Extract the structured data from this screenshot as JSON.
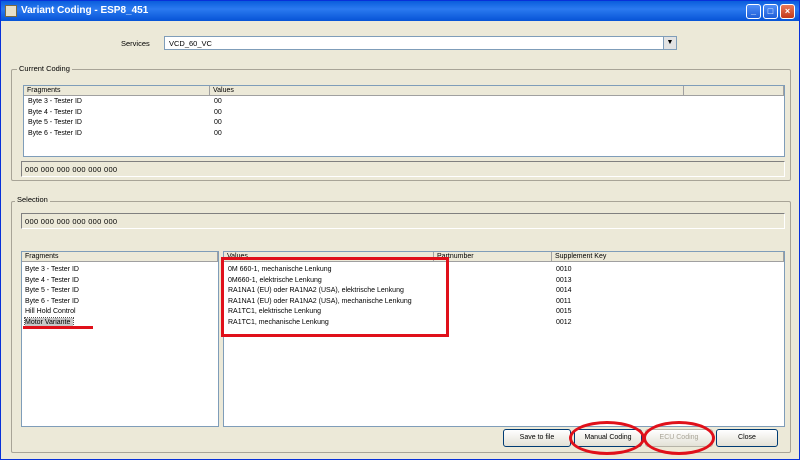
{
  "window": {
    "title": "Variant Coding - ESP8_451",
    "min_glyph": "_",
    "max_glyph": "□",
    "close_glyph": "×"
  },
  "services": {
    "label": "Services",
    "value": "VCD_60_VC",
    "arrow_glyph": "▼"
  },
  "current_coding": {
    "group_label": "Current Coding",
    "headers": [
      "Fragments",
      "Values"
    ],
    "rows": [
      {
        "fragment": "Byte 3 - Tester ID",
        "value": "00"
      },
      {
        "fragment": "Byte 4 - Tester ID",
        "value": "00"
      },
      {
        "fragment": "Byte 5 - Tester ID",
        "value": "00"
      },
      {
        "fragment": "Byte 6 - Tester ID",
        "value": "00"
      }
    ],
    "coding_string": "000  000  000  000  000  000"
  },
  "selection": {
    "group_label": "Selection",
    "coding_string": "000  000  000  000  000  000",
    "fragments_header": "Fragments",
    "fragments": [
      "Byte 3 - Tester ID",
      "Byte 4 - Tester ID",
      "Byte 5 - Tester ID",
      "Byte 6 - Tester ID",
      "Hill Hold Control",
      "Motor Variante"
    ],
    "selected_fragment_index": 5,
    "values_headers": [
      "Values",
      "Partnumber",
      "Supplement Key"
    ],
    "values": [
      {
        "value": "0M 660-1, mechanische Lenkung",
        "partnumber": "",
        "key": "0010"
      },
      {
        "value": "0M660-1, elektrische Lenkung",
        "partnumber": "",
        "key": "0013"
      },
      {
        "value": "RA1NA1 (EU) oder RA1NA2 (USA), elektrische Lenkung",
        "partnumber": "",
        "key": "0014"
      },
      {
        "value": "RA1NA1 (EU) oder RA1NA2 (USA), mechanische Lenkung",
        "partnumber": "",
        "key": "0011"
      },
      {
        "value": "RA1TC1, elektrische Lenkung",
        "partnumber": "",
        "key": "0015"
      },
      {
        "value": "RA1TC1, mechanische Lenkung",
        "partnumber": "",
        "key": "0012"
      }
    ]
  },
  "buttons": {
    "save_to_file": "Save to file",
    "manual_coding": "Manual Coding",
    "ecu_coding": "ECU Coding",
    "close": "Close"
  },
  "annotation_color": "#e0101a"
}
